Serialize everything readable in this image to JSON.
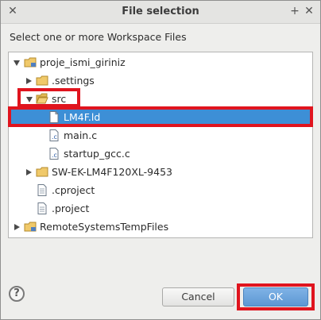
{
  "window": {
    "title": "File selection"
  },
  "prompt": "Select one or more Workspace Files",
  "tree": [
    {
      "label": "proje_ismi_giriniz",
      "state": "open",
      "icon": "project-folder-icon"
    },
    {
      "label": ".settings",
      "state": "closed",
      "icon": "folder-icon"
    },
    {
      "label": "src",
      "state": "open",
      "icon": "folder-open-icon"
    },
    {
      "label": "LM4F.ld",
      "state": "none",
      "icon": "file-icon",
      "selected": true
    },
    {
      "label": "main.c",
      "state": "none",
      "icon": "c-file-icon"
    },
    {
      "label": "startup_gcc.c",
      "state": "none",
      "icon": "c-file-icon"
    },
    {
      "label": "SW-EK-LM4F120XL-9453",
      "state": "closed",
      "icon": "folder-icon"
    },
    {
      "label": ".cproject",
      "state": "none",
      "icon": "file-icon"
    },
    {
      "label": ".project",
      "state": "none",
      "icon": "file-icon"
    },
    {
      "label": "RemoteSystemsTempFiles",
      "state": "closed",
      "icon": "project-folder-icon"
    }
  ],
  "buttons": {
    "help": "?",
    "cancel": "Cancel",
    "ok": "OK"
  },
  "colors": {
    "selection": "#3d8fd6",
    "annotation": "#e0141e"
  }
}
